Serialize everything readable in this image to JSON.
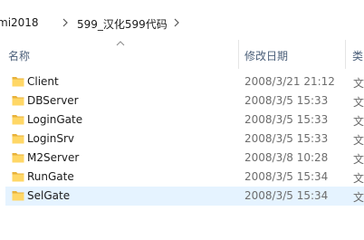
{
  "breadcrumb": {
    "items": [
      {
        "label": "mi2018"
      },
      {
        "label": "599_汉化599代码"
      }
    ]
  },
  "columns": {
    "name": "名称",
    "date": "修改日期",
    "type": "类"
  },
  "files": [
    {
      "name": "Client",
      "date": "2008/3/21 21:12",
      "type": "文"
    },
    {
      "name": "DBServer",
      "date": "2008/3/5 15:33",
      "type": "文"
    },
    {
      "name": "LoginGate",
      "date": "2008/3/5 15:33",
      "type": "文"
    },
    {
      "name": "LoginSrv",
      "date": "2008/3/5 15:33",
      "type": "文"
    },
    {
      "name": "M2Server",
      "date": "2008/3/8 10:28",
      "type": "文"
    },
    {
      "name": "RunGate",
      "date": "2008/3/5 15:34",
      "type": "文"
    },
    {
      "name": "SelGate",
      "date": "2008/3/5 15:34",
      "type": "文"
    }
  ],
  "selected_index": 6,
  "icons": {
    "folder": "folder-icon",
    "separator": "chevron-right-icon",
    "sort": "sort-up-icon"
  },
  "colors": {
    "folder_fill": "#ffd766",
    "folder_tab": "#e8b23a",
    "selection": "#e5f3ff",
    "header_text": "#4c607a"
  }
}
